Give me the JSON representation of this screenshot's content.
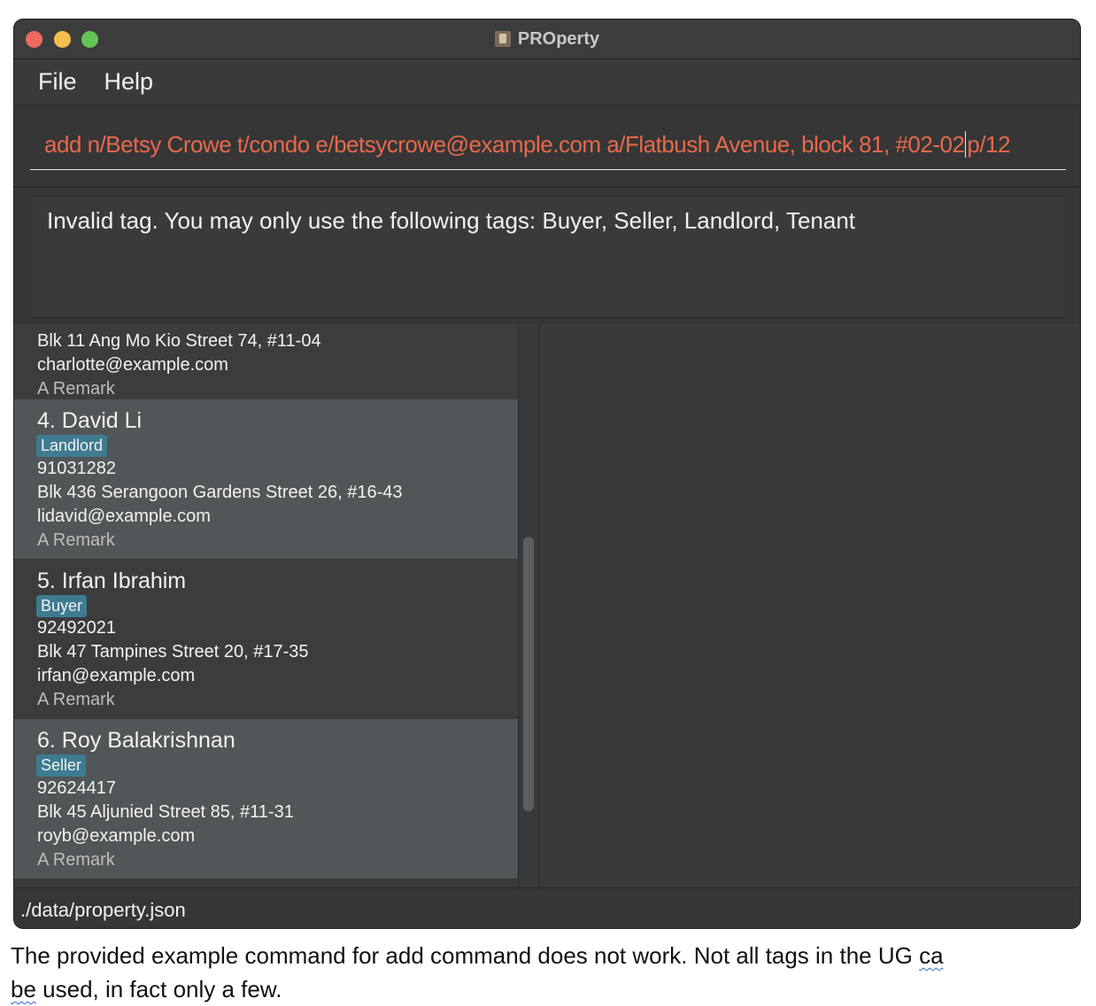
{
  "window": {
    "title": "PROperty"
  },
  "menu": {
    "items": [
      "File",
      "Help"
    ]
  },
  "command": {
    "value_before_caret": "add n/Betsy Crowe t/condo e/betsycrowe@example.com a/Flatbush Avenue, block 81, #02-02",
    "value_after_caret": "p/12",
    "color": "#e7694c"
  },
  "result": {
    "message": "Invalid tag. You may only use the following tags: Buyer, Seller, Landlord, Tenant"
  },
  "person_list": {
    "partial_card": {
      "address": "Blk 11 Ang Mo Kio Street 74, #11-04",
      "email": "charlotte@example.com",
      "remark": "A Remark"
    },
    "cards": [
      {
        "name": "4. David Li",
        "tag": "Landlord",
        "phone": "91031282",
        "address": "Blk 436 Serangoon Gardens Street 26, #16-43",
        "email": "lidavid@example.com",
        "remark": "A Remark"
      },
      {
        "name": "5. Irfan Ibrahim",
        "tag": "Buyer",
        "phone": "92492021",
        "address": "Blk 47 Tampines Street 20, #17-35",
        "email": "irfan@example.com",
        "remark": "A Remark"
      },
      {
        "name": "6. Roy Balakrishnan",
        "tag": "Seller",
        "phone": "92624417",
        "address": "Blk 45 Aljunied Street 85, #11-31",
        "email": "royb@example.com",
        "remark": "A Remark"
      }
    ]
  },
  "status": {
    "file_path": "./data/property.json"
  },
  "caption": {
    "line1_main": "The provided example command for add command does not work. Not all tags in the UG ",
    "line1_squiggle": "ca",
    "line2_squiggle": "be",
    "line2_main": " used, in fact only a few."
  },
  "colors": {
    "tag_background": "#3e7b91",
    "window_background": "#3a3a3a",
    "selected_card_background": "#515658"
  },
  "icons": [
    "close-dot",
    "minimize-dot",
    "zoom-dot",
    "app-icon"
  ]
}
